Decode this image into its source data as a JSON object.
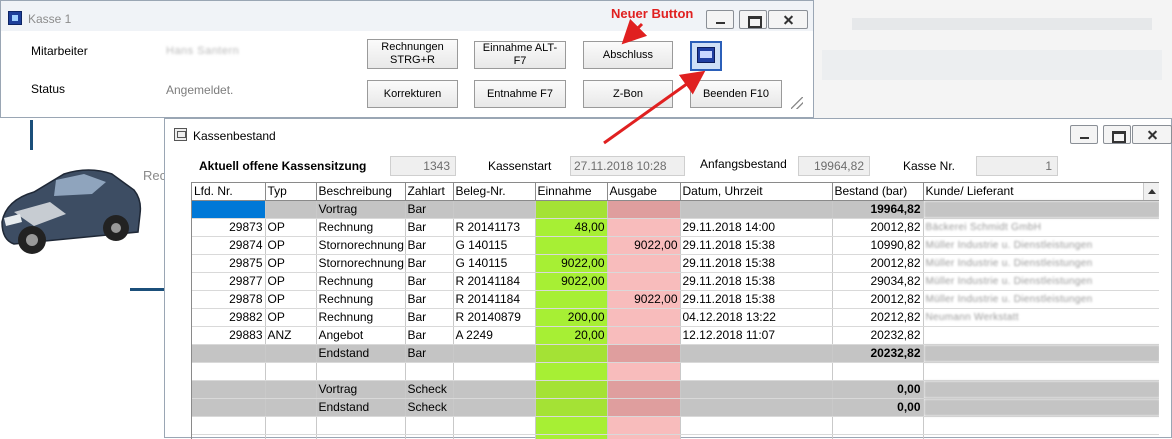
{
  "kasse_window": {
    "title": "Kasse 1",
    "mitarbeiter_label": "Mitarbeiter",
    "mitarbeiter_value": "Hans Santern",
    "status_label": "Status",
    "status_value": "Angemeldet.",
    "buttons": {
      "rechnungen_line1": "Rechnungen",
      "rechnungen_line2": "STRG+R",
      "einnahme_alt": "Einnahme ALT-F7",
      "abschluss": "Abschluss",
      "korrekturen": "Korrekturen",
      "entnahme": "Entnahme F7",
      "zbon": "Z-Bon",
      "beenden": "Beenden F10"
    },
    "icon_button": "keyboard-icon"
  },
  "annotation": {
    "label": "Neuer Button",
    "color": "#e02020"
  },
  "background": {
    "text": "Rec"
  },
  "kassenbestand_window": {
    "title": "Kassenbestand",
    "header": {
      "sitzung_label": "Aktuell offene Kassensitzung",
      "sitzung_value": "1343",
      "kassenstart_label": "Kassenstart",
      "kassenstart_value": "27.11.2018 10:28",
      "anfangsbestand_label": "Anfangsbestand",
      "anfangsbestand_value": "19964,82",
      "kasse_nr_label": "Kasse Nr.",
      "kasse_nr_value": "1"
    },
    "columns": [
      "Lfd. Nr.",
      "Typ",
      "Beschreibung",
      "Zahlart",
      "Beleg-Nr.",
      "Einnahme",
      "Ausgabe",
      "Datum, Uhrzeit",
      "Bestand (bar)",
      "Kunde/ Lieferant"
    ],
    "rows": [
      {
        "lfd": "",
        "typ": "",
        "beschreibung": "Vortrag",
        "zahlart": "Bar",
        "beleg": "",
        "einnahme": "",
        "ausgabe": "",
        "datum": "",
        "bestand": "19964,82",
        "kunde": ""
      },
      {
        "lfd": "29873",
        "typ": "OP",
        "beschreibung": "Rechnung",
        "zahlart": "Bar",
        "beleg": "R 20141173",
        "einnahme": "48,00",
        "ausgabe": "",
        "datum": "29.11.2018 14:00",
        "bestand": "20012,82",
        "kunde": "Bäckerei Schmidt GmbH"
      },
      {
        "lfd": "29874",
        "typ": "OP",
        "beschreibung": "Stornorechnung",
        "zahlart": "Bar",
        "beleg": "G 140115",
        "einnahme": "",
        "ausgabe": "9022,00",
        "datum": "29.11.2018 15:38",
        "bestand": "10990,82",
        "kunde": "Müller Industrie u. Dienstleistungen"
      },
      {
        "lfd": "29875",
        "typ": "OP",
        "beschreibung": "Stornorechnung",
        "zahlart": "Bar",
        "beleg": "G 140115",
        "einnahme": "9022,00",
        "ausgabe": "",
        "datum": "29.11.2018 15:38",
        "bestand": "20012,82",
        "kunde": "Müller Industrie u. Dienstleistungen"
      },
      {
        "lfd": "29877",
        "typ": "OP",
        "beschreibung": "Rechnung",
        "zahlart": "Bar",
        "beleg": "R 20141184",
        "einnahme": "9022,00",
        "ausgabe": "",
        "datum": "29.11.2018 15:38",
        "bestand": "29034,82",
        "kunde": "Müller Industrie u. Dienstleistungen"
      },
      {
        "lfd": "29878",
        "typ": "OP",
        "beschreibung": "Rechnung",
        "zahlart": "Bar",
        "beleg": "R 20141184",
        "einnahme": "",
        "ausgabe": "9022,00",
        "datum": "29.11.2018 15:38",
        "bestand": "20012,82",
        "kunde": "Müller Industrie u. Dienstleistungen"
      },
      {
        "lfd": "29882",
        "typ": "OP",
        "beschreibung": "Rechnung",
        "zahlart": "Bar",
        "beleg": "R 20140879",
        "einnahme": "200,00",
        "ausgabe": "",
        "datum": "04.12.2018 13:22",
        "bestand": "20212,82",
        "kunde": "Neumann Werkstatt"
      },
      {
        "lfd": "29883",
        "typ": "ANZ",
        "beschreibung": "Angebot",
        "zahlart": "Bar",
        "beleg": "A 2249",
        "einnahme": "20,00",
        "ausgabe": "",
        "datum": "12.12.2018 11:07",
        "bestand": "20232,82",
        "kunde": ""
      },
      {
        "lfd": "",
        "typ": "",
        "beschreibung": "Endstand",
        "zahlart": "Bar",
        "beleg": "",
        "einnahme": "",
        "ausgabe": "",
        "datum": "",
        "bestand": "20232,82",
        "kunde": ""
      },
      {
        "lfd": "",
        "typ": "",
        "beschreibung": "",
        "zahlart": "",
        "beleg": "",
        "einnahme": "",
        "ausgabe": "",
        "datum": "",
        "bestand": "",
        "kunde": ""
      },
      {
        "lfd": "",
        "typ": "",
        "beschreibung": "Vortrag",
        "zahlart": "Scheck",
        "beleg": "",
        "einnahme": "",
        "ausgabe": "",
        "datum": "",
        "bestand": "0,00",
        "kunde": ""
      },
      {
        "lfd": "",
        "typ": "",
        "beschreibung": "Endstand",
        "zahlart": "Scheck",
        "beleg": "",
        "einnahme": "",
        "ausgabe": "",
        "datum": "",
        "bestand": "0,00",
        "kunde": ""
      },
      {
        "lfd": "",
        "typ": "",
        "beschreibung": "",
        "zahlart": "",
        "beleg": "",
        "einnahme": "",
        "ausgabe": "",
        "datum": "",
        "bestand": "",
        "kunde": ""
      },
      {
        "lfd": "",
        "typ": "",
        "beschreibung": "",
        "zahlart": "",
        "beleg": "",
        "einnahme": "",
        "ausgabe": "",
        "datum": "",
        "bestand": "",
        "kunde": ""
      }
    ]
  }
}
